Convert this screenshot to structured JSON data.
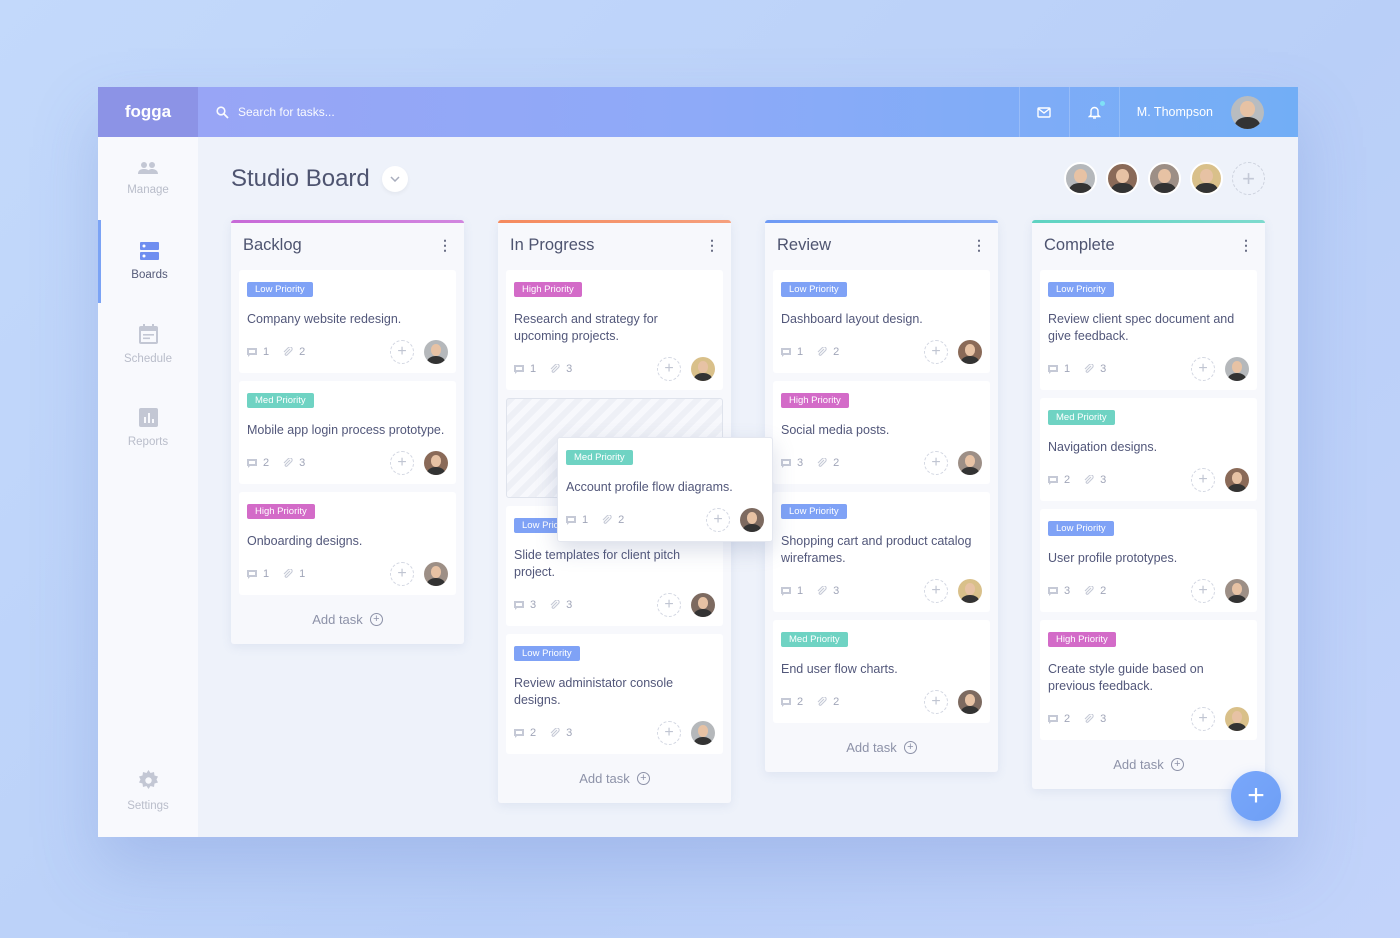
{
  "app": {
    "logo": "fogga",
    "search_placeholder": "Search for tasks...",
    "user_name": "M. Thompson",
    "notification_dot_color": "#7ee0f6"
  },
  "sidebar": {
    "items": [
      {
        "label": "Manage",
        "icon": "users-icon"
      },
      {
        "label": "Boards",
        "icon": "boards-icon",
        "active": true
      },
      {
        "label": "Schedule",
        "icon": "calendar-icon"
      },
      {
        "label": "Reports",
        "icon": "chart-icon"
      },
      {
        "label": "Settings",
        "icon": "gear-icon"
      }
    ]
  },
  "board": {
    "title": "Studio Board",
    "add_task_label": "Add task"
  },
  "priority_colors": {
    "Low Priority": "#7fa2f6",
    "High Priority": "#d36bc8",
    "Med Priority": "#6fd3c3"
  },
  "columns": [
    {
      "name": "Backlog",
      "accent": "#c86ad8",
      "cards": [
        {
          "priority": "Low Priority",
          "title": "Company website redesign.",
          "comments": "1",
          "attachments": "2"
        },
        {
          "priority": "Med Priority",
          "title": "Mobile app login process prototype.",
          "comments": "2",
          "attachments": "3"
        },
        {
          "priority": "High Priority",
          "title": "Onboarding designs.",
          "comments": "1",
          "attachments": "1"
        }
      ]
    },
    {
      "name": "In Progress",
      "accent": "#f58a5e",
      "cards": [
        {
          "priority": "High Priority",
          "title": "Research and strategy for upcoming projects.",
          "comments": "1",
          "attachments": "3"
        },
        {
          "placeholder": true
        },
        {
          "priority": "Low Priority",
          "title": "Slide templates for client pitch project.",
          "comments": "3",
          "attachments": "3"
        },
        {
          "priority": "Low Priority",
          "title": "Review administator console designs.",
          "comments": "2",
          "attachments": "3"
        }
      ]
    },
    {
      "name": "Review",
      "accent": "#6e9af5",
      "cards": [
        {
          "priority": "Low Priority",
          "title": "Dashboard layout design.",
          "comments": "1",
          "attachments": "2"
        },
        {
          "priority": "High Priority",
          "title": "Social media posts.",
          "comments": "3",
          "attachments": "2"
        },
        {
          "priority": "Low Priority",
          "title": "Shopping cart and product catalog wireframes.",
          "comments": "1",
          "attachments": "3"
        },
        {
          "priority": "Med Priority",
          "title": "End user flow charts.",
          "comments": "2",
          "attachments": "2"
        }
      ]
    },
    {
      "name": "Complete",
      "accent": "#5fd3c2",
      "cards": [
        {
          "priority": "Low Priority",
          "title": "Review client spec document and give feedback.",
          "comments": "1",
          "attachments": "3"
        },
        {
          "priority": "Med Priority",
          "title": "Navigation designs.",
          "comments": "2",
          "attachments": "3"
        },
        {
          "priority": "Low Priority",
          "title": "User profile prototypes.",
          "comments": "3",
          "attachments": "2"
        },
        {
          "priority": "High Priority",
          "title": "Create style guide based on previous feedback.",
          "comments": "2",
          "attachments": "3"
        }
      ]
    }
  ],
  "dragged_card": {
    "priority": "Med Priority",
    "title": "Account profile flow diagrams.",
    "comments": "1",
    "attachments": "2"
  }
}
